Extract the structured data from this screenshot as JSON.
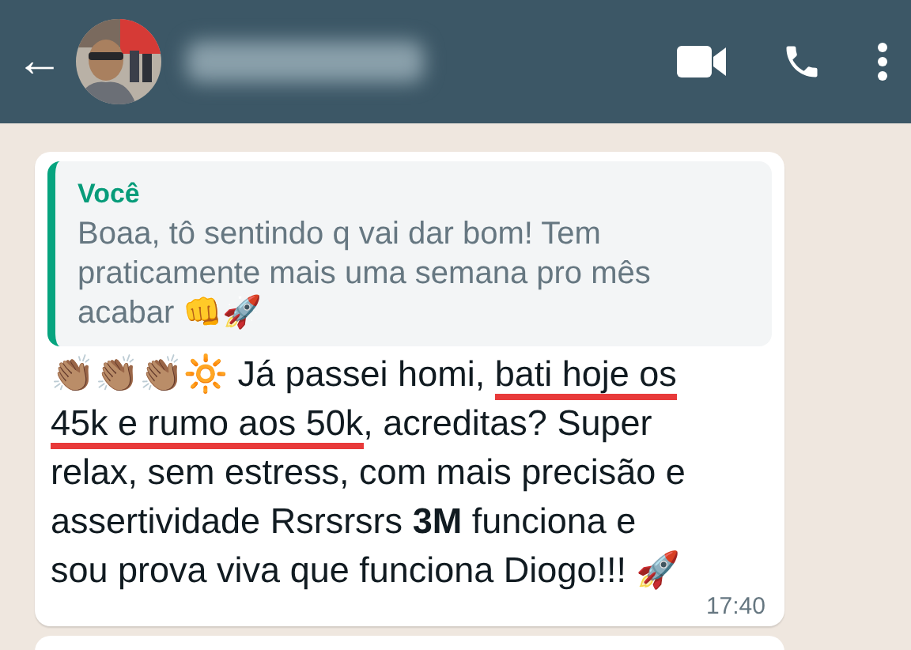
{
  "header": {
    "back": "←"
  },
  "message": {
    "quote": {
      "author": "Você",
      "text": "Boaa, tô sentindo q vai dar bom! Tem praticamente mais uma semana pro mês acabar 👊🚀"
    },
    "segments": [
      {
        "text": "👏🏽👏🏽👏🏽🔆 Já passei homi, ",
        "underlined": false
      },
      {
        "text": "bati hoje os 45k e rumo aos 50k",
        "underlined": true
      },
      {
        "text": ", acreditas? Super relax, sem estress, com mais precisão e assertividade Rsrsrsrs **3M** funciona e sou prova viva que funciona Diogo!!! 🚀",
        "underlined": false
      }
    ],
    "time": "17:40"
  }
}
